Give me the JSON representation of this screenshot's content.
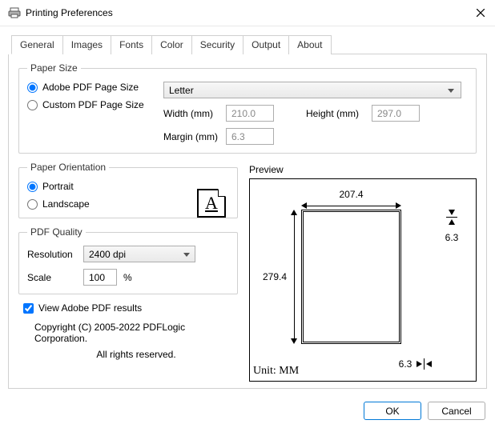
{
  "window": {
    "title": "Printing Preferences"
  },
  "tabs": [
    "General",
    "Images",
    "Fonts",
    "Color",
    "Security",
    "Output",
    "About"
  ],
  "paper_size": {
    "legend": "Paper Size",
    "adobe_label": "Adobe PDF Page Size",
    "custom_label": "Custom PDF Page Size",
    "selected": "adobe",
    "preset": "Letter",
    "width_label": "Width (mm)",
    "width_value": "210.0",
    "height_label": "Height (mm)",
    "height_value": "297.0",
    "margin_label": "Margin (mm)",
    "margin_value": "6.3"
  },
  "orientation": {
    "legend": "Paper Orientation",
    "portrait_label": "Portrait",
    "landscape_label": "Landscape",
    "selected": "portrait",
    "icon_letter": "A"
  },
  "quality": {
    "legend": "PDF Quality",
    "resolution_label": "Resolution",
    "resolution_value": "2400 dpi",
    "scale_label": "Scale",
    "scale_value": "100",
    "scale_unit": "%"
  },
  "view_results": {
    "label": "View Adobe PDF results",
    "checked": true
  },
  "copyright": {
    "line1": "Copyright (C) 2005-2022 PDFLogic Corporation.",
    "line2": "All rights reserved."
  },
  "preview": {
    "label": "Preview",
    "width": "207.4",
    "height": "279.4",
    "margin_r": "6.3",
    "margin_b": "6.3",
    "unit": "Unit: MM"
  },
  "buttons": {
    "ok": "OK",
    "cancel": "Cancel"
  }
}
